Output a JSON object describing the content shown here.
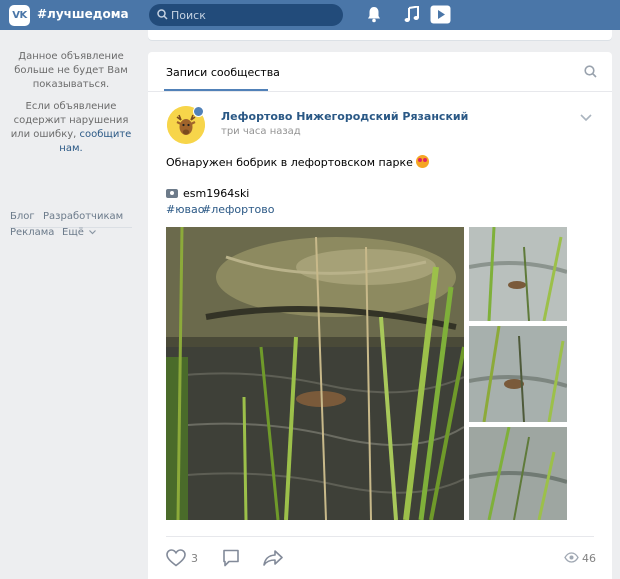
{
  "header": {
    "logo_text": "VK",
    "brand": "#лучшедома",
    "search_placeholder": "Поиск",
    "accent": "#4a76a8"
  },
  "sidebar": {
    "ad_notice_1": "Данное объявление больше не будет Вам показываться.",
    "ad_notice_2a": "Если объявление содержит нарушения или ошибку,",
    "ad_notice_2b": "сообщите нам.",
    "footer": [
      "Блог",
      "Разработчикам",
      "Реклама",
      "Ещё"
    ]
  },
  "feed": {
    "tab_label": "Записи сообщества",
    "post": {
      "author": "Лефортово Нижегородский Рязанский",
      "time": "три часа назад",
      "text": "Обнаружен бобрик в лефортовском парке",
      "credit": "esm1964ski",
      "tags": [
        "#ювао",
        "#лефортово"
      ],
      "likes": "3",
      "views": "46"
    }
  }
}
